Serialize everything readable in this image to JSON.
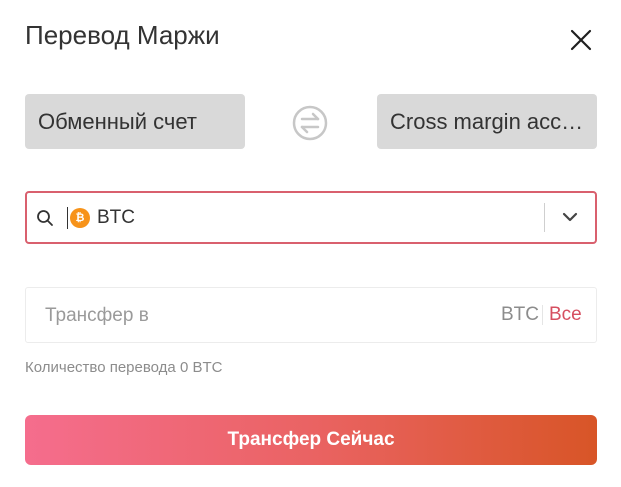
{
  "dialog": {
    "title": "Перевод Маржи"
  },
  "accounts": {
    "from_label": "Обменный счет",
    "to_label": "Cross margin acco..."
  },
  "coin_select": {
    "icon_glyph": "₿",
    "symbol": "BTC",
    "coin_color": "#f7931a"
  },
  "amount": {
    "placeholder": "Трансфер в",
    "unit": "BTC",
    "all_label": "Все"
  },
  "quantity": {
    "text": "Количество перевода 0 BTC"
  },
  "submit": {
    "label": "Трансфер Сейчас"
  },
  "colors": {
    "accent": "#d64f60",
    "error_border": "#d9606e",
    "gradient_start": "#f56d8d",
    "gradient_end": "#d85527"
  }
}
